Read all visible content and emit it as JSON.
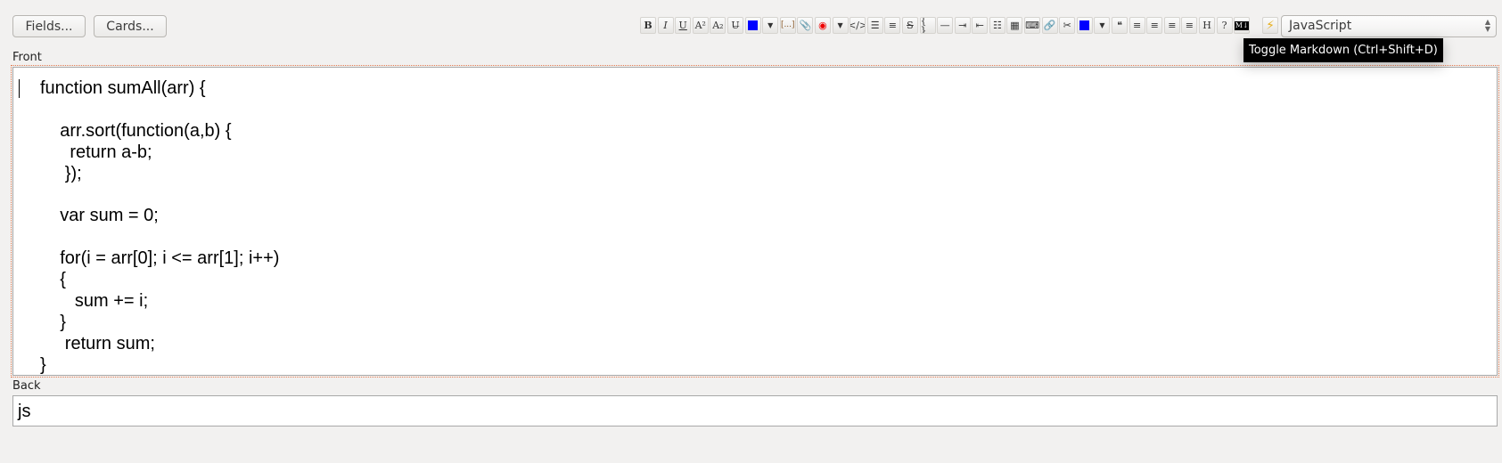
{
  "buttons": {
    "fields": "Fields...",
    "cards": "Cards..."
  },
  "toolbar": [
    {
      "name": "bold",
      "glyph": "B"
    },
    {
      "name": "italic",
      "glyph": "I"
    },
    {
      "name": "underline",
      "glyph": "U"
    },
    {
      "name": "superscript",
      "glyph": "A²"
    },
    {
      "name": "subscript",
      "glyph": "A₂"
    },
    {
      "name": "remove-format",
      "glyph": "U̶"
    },
    {
      "name": "text-color",
      "glyph": ""
    },
    {
      "name": "text-color-dropdown",
      "glyph": "▼"
    },
    {
      "name": "cloze",
      "glyph": "[...]"
    },
    {
      "name": "attach",
      "glyph": "📎"
    },
    {
      "name": "record-audio",
      "glyph": "◉"
    },
    {
      "name": "more-dropdown",
      "glyph": "▼"
    },
    {
      "name": "code",
      "glyph": "</>"
    },
    {
      "name": "unordered-list",
      "glyph": "☰"
    },
    {
      "name": "ordered-list",
      "glyph": "≡"
    },
    {
      "name": "strikethrough",
      "glyph": "S"
    },
    {
      "name": "code-block",
      "glyph": "{ }"
    },
    {
      "name": "horizontal-rule",
      "glyph": "—"
    },
    {
      "name": "indent",
      "glyph": "⇥"
    },
    {
      "name": "outdent",
      "glyph": "⇤"
    },
    {
      "name": "definition-list",
      "glyph": "☷"
    },
    {
      "name": "table",
      "glyph": "▦"
    },
    {
      "name": "keyboard",
      "glyph": "⌨"
    },
    {
      "name": "link",
      "glyph": "🔗"
    },
    {
      "name": "unlink",
      "glyph": "✂"
    },
    {
      "name": "background-color",
      "glyph": ""
    },
    {
      "name": "background-color-dropdown",
      "glyph": "▼"
    },
    {
      "name": "blockquote",
      "glyph": "❝"
    },
    {
      "name": "align-left",
      "glyph": "≡"
    },
    {
      "name": "align-center",
      "glyph": "≡"
    },
    {
      "name": "align-right",
      "glyph": "≡"
    },
    {
      "name": "justify",
      "glyph": "≡"
    },
    {
      "name": "heading",
      "glyph": "H"
    },
    {
      "name": "help",
      "glyph": "?"
    },
    {
      "name": "markdown",
      "glyph": "M↓"
    }
  ],
  "colors": {
    "text_color": "#0000ff",
    "bg_color": "#0000ff",
    "accent": "#e07a50"
  },
  "language_select": {
    "value": "JavaScript"
  },
  "tooltip": "Toggle Markdown (Ctrl+Shift+D)",
  "fields": {
    "front_label": "Front",
    "front_lines": [
      "function sumAll(arr) {",
      "",
      "    arr.sort(function(a,b) {",
      "      return a-b;",
      "     });",
      "",
      "    var sum = 0;",
      "",
      "    for(i = arr[0]; i <= arr[1]; i++)",
      "    {",
      "       sum += i;",
      "    }",
      "     return sum;",
      "}"
    ],
    "back_label": "Back",
    "back_value": "js"
  }
}
